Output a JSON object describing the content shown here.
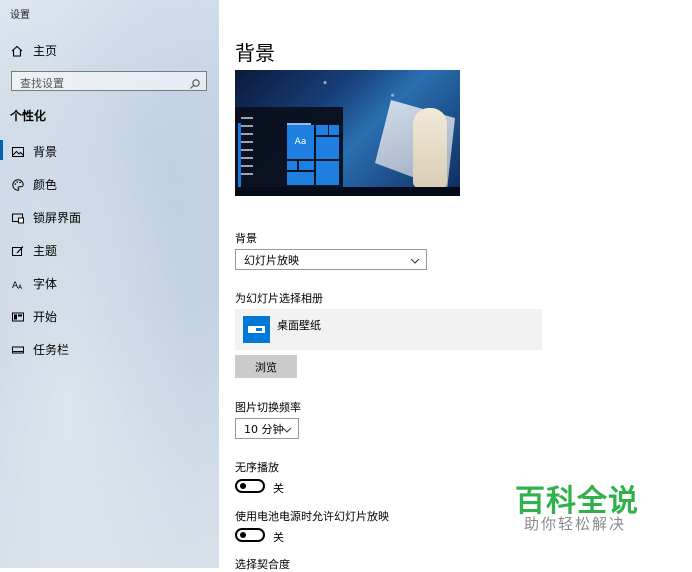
{
  "window": {
    "title": "设置"
  },
  "sidebar": {
    "home_label": "主页",
    "search_placeholder": "查找设置",
    "section_title": "个性化",
    "items": [
      {
        "label": "背景",
        "icon": "picture-icon",
        "active": true
      },
      {
        "label": "颜色",
        "icon": "palette-icon"
      },
      {
        "label": "锁屏界面",
        "icon": "lock-screen-icon"
      },
      {
        "label": "主题",
        "icon": "theme-brush-icon"
      },
      {
        "label": "字体",
        "icon": "font-icon"
      },
      {
        "label": "开始",
        "icon": "start-menu-icon"
      },
      {
        "label": "任务栏",
        "icon": "taskbar-icon"
      }
    ]
  },
  "main": {
    "title": "背景",
    "preview": {
      "tile_label": "Aa"
    },
    "background_label": "背景",
    "background_value": "幻灯片放映",
    "album_label": "为幻灯片选择相册",
    "album_name": "桌面壁纸",
    "browse_label": "浏览",
    "interval_label": "图片切换频率",
    "interval_value": "10 分钟",
    "shuffle_label": "无序播放",
    "shuffle_state": "关",
    "battery_label": "使用电池电源时允许幻灯片放映",
    "battery_state": "关",
    "fit_label": "选择契合度"
  },
  "watermark": {
    "main": "百科全说",
    "sub": "助你轻松解决"
  },
  "colors": {
    "accent": "#0078d7",
    "watermark_green": "#2fb24c"
  }
}
